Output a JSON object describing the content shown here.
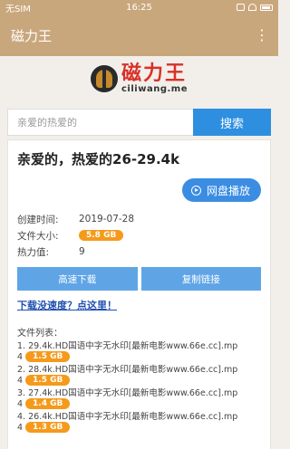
{
  "statusbar": {
    "carrier": "无SIM",
    "time": "16:25"
  },
  "appbar": {
    "title": "磁力王"
  },
  "logo": {
    "cn": "磁力王",
    "en": "ciliwang.me"
  },
  "search": {
    "placeholder": "亲爱的热爱的",
    "button": "搜索"
  },
  "detail": {
    "title": "亲爱的，热爱的26-29.4k",
    "play_button": "网盘播放",
    "created_label": "创建时间:",
    "created_value": "2019-07-28",
    "size_label": "文件大小:",
    "size_value": "5.8 GB",
    "hot_label": "热力值:",
    "hot_value": "9",
    "download_button": "高速下载",
    "copy_button": "复制链接",
    "slow_link": "下载没速度？点这里！",
    "files_title": "文件列表：",
    "files": [
      {
        "name": "1. 29.4k.HD国语中字无水印[最新电影www.66e.cc].mp",
        "tail": "4",
        "size": "1.5 GB"
      },
      {
        "name": "2. 28.4k.HD国语中字无水印[最新电影www.66e.cc].mp",
        "tail": "4",
        "size": "1.5 GB"
      },
      {
        "name": "3. 27.4k.HD国语中字无水印[最新电影www.66e.cc].mp",
        "tail": "4",
        "size": "1.4 GB"
      },
      {
        "name": "4. 26.4k.HD国语中字无水印[最新电影www.66e.cc].mp",
        "tail": "4",
        "size": "1.3 GB"
      }
    ]
  },
  "colors": {
    "brand": "#c9a77c",
    "primary": "#2e8fe0",
    "badge": "#f59a1b",
    "link": "#1f4fb0"
  }
}
